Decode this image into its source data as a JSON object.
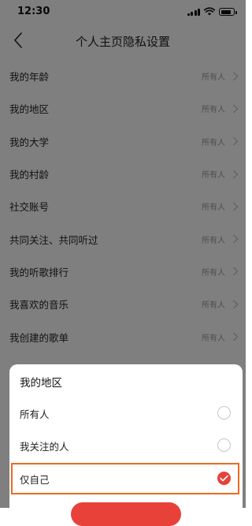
{
  "status_bar": {
    "time": "12:30",
    "battery_level": 0.8
  },
  "header": {
    "title": "个人主页隐私设置",
    "back_icon": "chevron-left-icon"
  },
  "settings": [
    {
      "label": "我的年龄",
      "value": "所有人"
    },
    {
      "label": "我的地区",
      "value": "所有人"
    },
    {
      "label": "我的大学",
      "value": "所有人"
    },
    {
      "label": "我的村龄",
      "value": "所有人"
    },
    {
      "label": "社交账号",
      "value": "所有人"
    },
    {
      "label": "共同关注、共同听过",
      "value": "所有人"
    },
    {
      "label": "我的听歌排行",
      "value": "所有人"
    },
    {
      "label": "我喜欢的音乐",
      "value": "所有人"
    },
    {
      "label": "我创建的歌单",
      "value": "所有人"
    }
  ],
  "sheet": {
    "title": "我的地区",
    "options": [
      {
        "label": "所有人",
        "selected": false
      },
      {
        "label": "我关注的人",
        "selected": false
      },
      {
        "label": "仅自己",
        "selected": true
      }
    ],
    "accent_color": "#e8413a",
    "highlight_color": "#ed6a1f"
  }
}
